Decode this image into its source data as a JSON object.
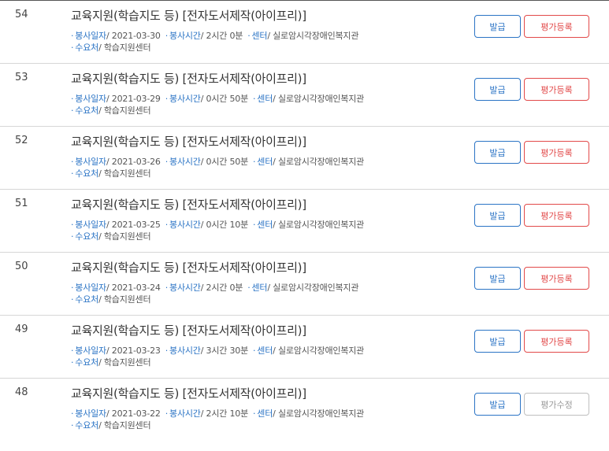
{
  "labels": {
    "date": "봉사일자",
    "time": "봉사시간",
    "center": "센터",
    "org": "수요처"
  },
  "rows": [
    {
      "no": "54",
      "title": "교육지원(학습지도 등) [전자도서제작(아이프리)]",
      "date": "2021-03-30",
      "time": "2시간 0분",
      "center": "실로암시각장애인복지관",
      "org": "학습지원센터",
      "issue": "발급",
      "eval": "평가등록"
    },
    {
      "no": "53",
      "title": "교육지원(학습지도 등) [전자도서제작(아이프리)]",
      "date": "2021-03-29",
      "time": "0시간 50분",
      "center": "실로암시각장애인복지관",
      "org": "학습지원센터",
      "issue": "발급",
      "eval": "평가등록"
    },
    {
      "no": "52",
      "title": "교육지원(학습지도 등) [전자도서제작(아이프리)]",
      "date": "2021-03-26",
      "time": "0시간 50분",
      "center": "실로암시각장애인복지관",
      "org": "학습지원센터",
      "issue": "발급",
      "eval": "평가등록"
    },
    {
      "no": "51",
      "title": "교육지원(학습지도 등) [전자도서제작(아이프리)]",
      "date": "2021-03-25",
      "time": "0시간 10분",
      "center": "실로암시각장애인복지관",
      "org": "학습지원센터",
      "issue": "발급",
      "eval": "평가등록"
    },
    {
      "no": "50",
      "title": "교육지원(학습지도 등) [전자도서제작(아이프리)]",
      "date": "2021-03-24",
      "time": "2시간 0분",
      "center": "실로암시각장애인복지관",
      "org": "학습지원센터",
      "issue": "발급",
      "eval": "평가등록"
    },
    {
      "no": "49",
      "title": "교육지원(학습지도 등) [전자도서제작(아이프리)]",
      "date": "2021-03-23",
      "time": "3시간 30분",
      "center": "실로암시각장애인복지관",
      "org": "학습지원센터",
      "issue": "발급",
      "eval": "평가등록"
    },
    {
      "no": "48",
      "title": "교육지원(학습지도 등) [전자도서제작(아이프리)]",
      "date": "2021-03-22",
      "time": "2시간 10분",
      "center": "실로암시각장애인복지관",
      "org": "학습지원센터",
      "issue": "발급",
      "eval": "평가수정"
    }
  ],
  "colors": {
    "accent": "#2b74c5",
    "danger": "#e24a4a",
    "muted": "#999999"
  }
}
